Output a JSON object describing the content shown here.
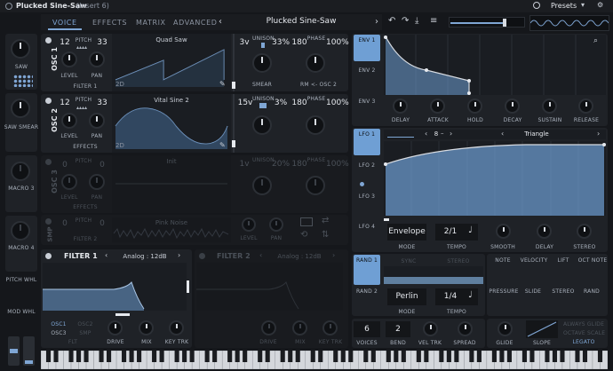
{
  "window": {
    "title": "Plucked Sine-Saw",
    "subtitle": "(Insert 6)",
    "presets_label": "Presets"
  },
  "tabs": [
    {
      "label": "VOICE"
    },
    {
      "label": "EFFECTS"
    },
    {
      "label": "MATRIX"
    },
    {
      "label": "ADVANCED"
    }
  ],
  "preset_name": "Plucked Sine-Saw",
  "left_column": {
    "saw_label": "SAW",
    "saw_smear_label": "SAW SMEAR",
    "macro3_label": "MACRO 3",
    "macro4_label": "MACRO 4",
    "pitch_whl": "PITCH WHL",
    "mod_whl": "MOD WHL"
  },
  "osc1": {
    "label": "OSC 1",
    "pitch_a": "12",
    "pitch_label": "PITCH",
    "pitch_b": "33",
    "level": "LEVEL",
    "pan": "PAN",
    "filter": "FILTER 1",
    "wave_name": "Quad Saw",
    "dim": "2D",
    "unison_voices": "3v",
    "unison_label": "UNISON",
    "unison_pct": "33%",
    "phase_val": "180",
    "phase_label": "PHASE",
    "phase_pct": "100%",
    "smear": "SMEAR",
    "rm": "RM <- OSC 2"
  },
  "osc2": {
    "label": "OSC 2",
    "pitch_a": "12",
    "pitch_label": "PITCH",
    "pitch_b": "33",
    "level": "LEVEL",
    "pan": "PAN",
    "effects": "EFFECTS",
    "wave_name": "Vital Sine 2",
    "dim": "2D",
    "unison_voices": "15v",
    "unison_label": "UNISON",
    "unison_pct": "3%",
    "phase_val": "180",
    "phase_label": "PHASE",
    "phase_pct": "100%"
  },
  "osc3": {
    "label": "OSC 3",
    "pitch_a": "0",
    "pitch_label": "PITCH",
    "pitch_b": "0",
    "level": "LEVEL",
    "pan": "PAN",
    "effects": "EFFECTS",
    "wave_name": "Init",
    "dim": "",
    "unison_voices": "1v",
    "unison_label": "UNISON",
    "unison_pct": "20%",
    "phase_val": "180",
    "phase_label": "PHASE",
    "phase_pct": "100%"
  },
  "smp": {
    "label": "SMP",
    "pitch_a": "0",
    "pitch_label": "PITCH",
    "pitch_b": "0",
    "filter": "FILTER 2",
    "name": "Pink Noise",
    "level": "LEVEL",
    "pan": "PAN"
  },
  "filter1": {
    "label": "FILTER 1",
    "model": "Analog : 12dB",
    "osc1": "OSC1",
    "osc2": "OSC2",
    "osc3": "OSC3",
    "smp": "SMP",
    "flt": "FLT",
    "drive": "DRIVE",
    "mix": "MIX",
    "keytrk": "KEY TRK"
  },
  "filter2": {
    "label": "FILTER 2",
    "model": "Analog : 12dB",
    "drive": "DRIVE",
    "mix": "MIX",
    "keytrk": "KEY TRK"
  },
  "env": {
    "tabs": [
      {
        "label": "ENV 1"
      },
      {
        "label": "ENV 2"
      },
      {
        "label": "ENV 3"
      }
    ],
    "knobs": [
      {
        "label": "DELAY"
      },
      {
        "label": "ATTACK"
      },
      {
        "label": "HOLD"
      },
      {
        "label": "DECAY"
      },
      {
        "label": "SUSTAIN"
      },
      {
        "label": "RELEASE"
      }
    ]
  },
  "lfo": {
    "tabs": [
      {
        "label": "LFO 1"
      },
      {
        "label": "LFO 2"
      },
      {
        "label": "LFO 3"
      },
      {
        "label": "LFO 4"
      }
    ],
    "shape": "Triangle",
    "grid": "8",
    "env_mode": "Envelope",
    "tempo": "2/1",
    "mode_label": "MODE",
    "tempo_label": "TEMPO",
    "smooth": "SMOOTH",
    "delay": "DELAY",
    "stereo": "STEREO"
  },
  "random": {
    "tabs": [
      {
        "label": "RAND 1"
      },
      {
        "label": "RAND 2"
      }
    ],
    "sync": "SYNC",
    "stereo": "STEREO",
    "type": "Perlin",
    "tempo": "1/4",
    "mode_label": "MODE",
    "tempo_label": "TEMPO"
  },
  "sources": [
    {
      "label": "NOTE"
    },
    {
      "label": "VELOCITY"
    },
    {
      "label": "LIFT"
    },
    {
      "label": "OCT NOTE"
    },
    {
      "label": "PRESSURE"
    },
    {
      "label": "SLIDE"
    },
    {
      "label": "STEREO"
    },
    {
      "label": "RAND"
    }
  ],
  "voice": {
    "voices": "6",
    "voices_label": "VOICES",
    "bend": "2",
    "bend_label": "BEND",
    "veltrk": "VEL TRK",
    "spread": "SPREAD",
    "glide": "GLIDE",
    "slope": "SLOPE",
    "always_glide": "ALWAYS GLIDE",
    "octave_scale": "OCTAVE SCALE",
    "legato": "LEGATO"
  },
  "colors": {
    "accent": "#7fa6d4",
    "panel": "#1f2227",
    "background": "#15171b"
  }
}
